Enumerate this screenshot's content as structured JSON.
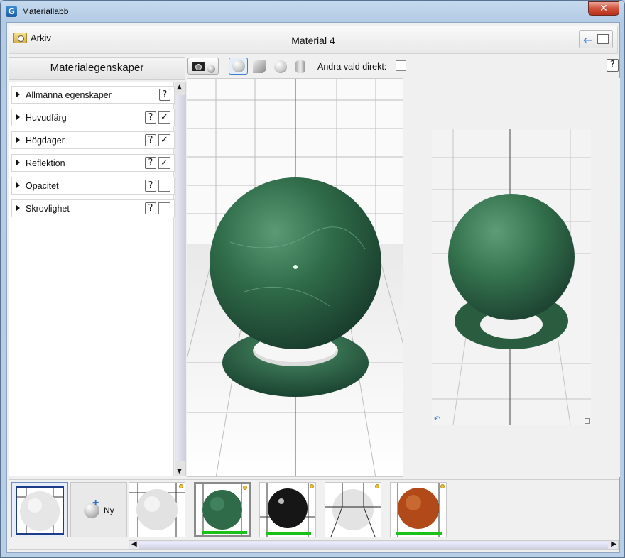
{
  "window": {
    "title": "Materiallabb",
    "app_icon_glyph": "G",
    "close_glyph": "✕"
  },
  "menubar": {
    "file_label": "Arkiv",
    "material_title": "Material 4",
    "back_icon": "arrow-left-icon"
  },
  "left_panel": {
    "header": "Materialegenskaper",
    "properties": [
      {
        "label": "Allmänna egenskaper",
        "help": "?",
        "has_checkbox": false,
        "checked": false
      },
      {
        "label": "Huvudfärg",
        "help": "?",
        "has_checkbox": true,
        "checked": true
      },
      {
        "label": "Högdager",
        "help": "?",
        "has_checkbox": true,
        "checked": true
      },
      {
        "label": "Reflektion",
        "help": "?",
        "has_checkbox": true,
        "checked": true
      },
      {
        "label": "Opacitet",
        "help": "?",
        "has_checkbox": true,
        "checked": false
      },
      {
        "label": "Skrovlighet",
        "help": "?",
        "has_checkbox": true,
        "checked": false
      }
    ]
  },
  "toolbar": {
    "shapes": [
      "sphere-on-ring",
      "cube",
      "sphere",
      "cylinder"
    ],
    "selected_shape": "sphere-on-ring",
    "direct_label": "Ändra vald direkt:",
    "direct_checked": false,
    "help": "?"
  },
  "thumbnails": {
    "new_label": "Ny",
    "items": [
      {
        "material": "white-marble",
        "selected": true,
        "has_bar": false
      },
      {
        "material": "white-marble",
        "selected": false,
        "has_bar": false
      },
      {
        "material": "green-marble",
        "selected": false,
        "has_bar": true
      },
      {
        "material": "black-gloss",
        "selected": false,
        "has_bar": true
      },
      {
        "material": "transparent",
        "selected": false,
        "has_bar": false
      },
      {
        "material": "copper",
        "selected": false,
        "has_bar": true
      }
    ]
  },
  "colors": {
    "green_marble": "#2f6b48",
    "status_bar": "#19c119",
    "accent": "#3f7ec4"
  }
}
